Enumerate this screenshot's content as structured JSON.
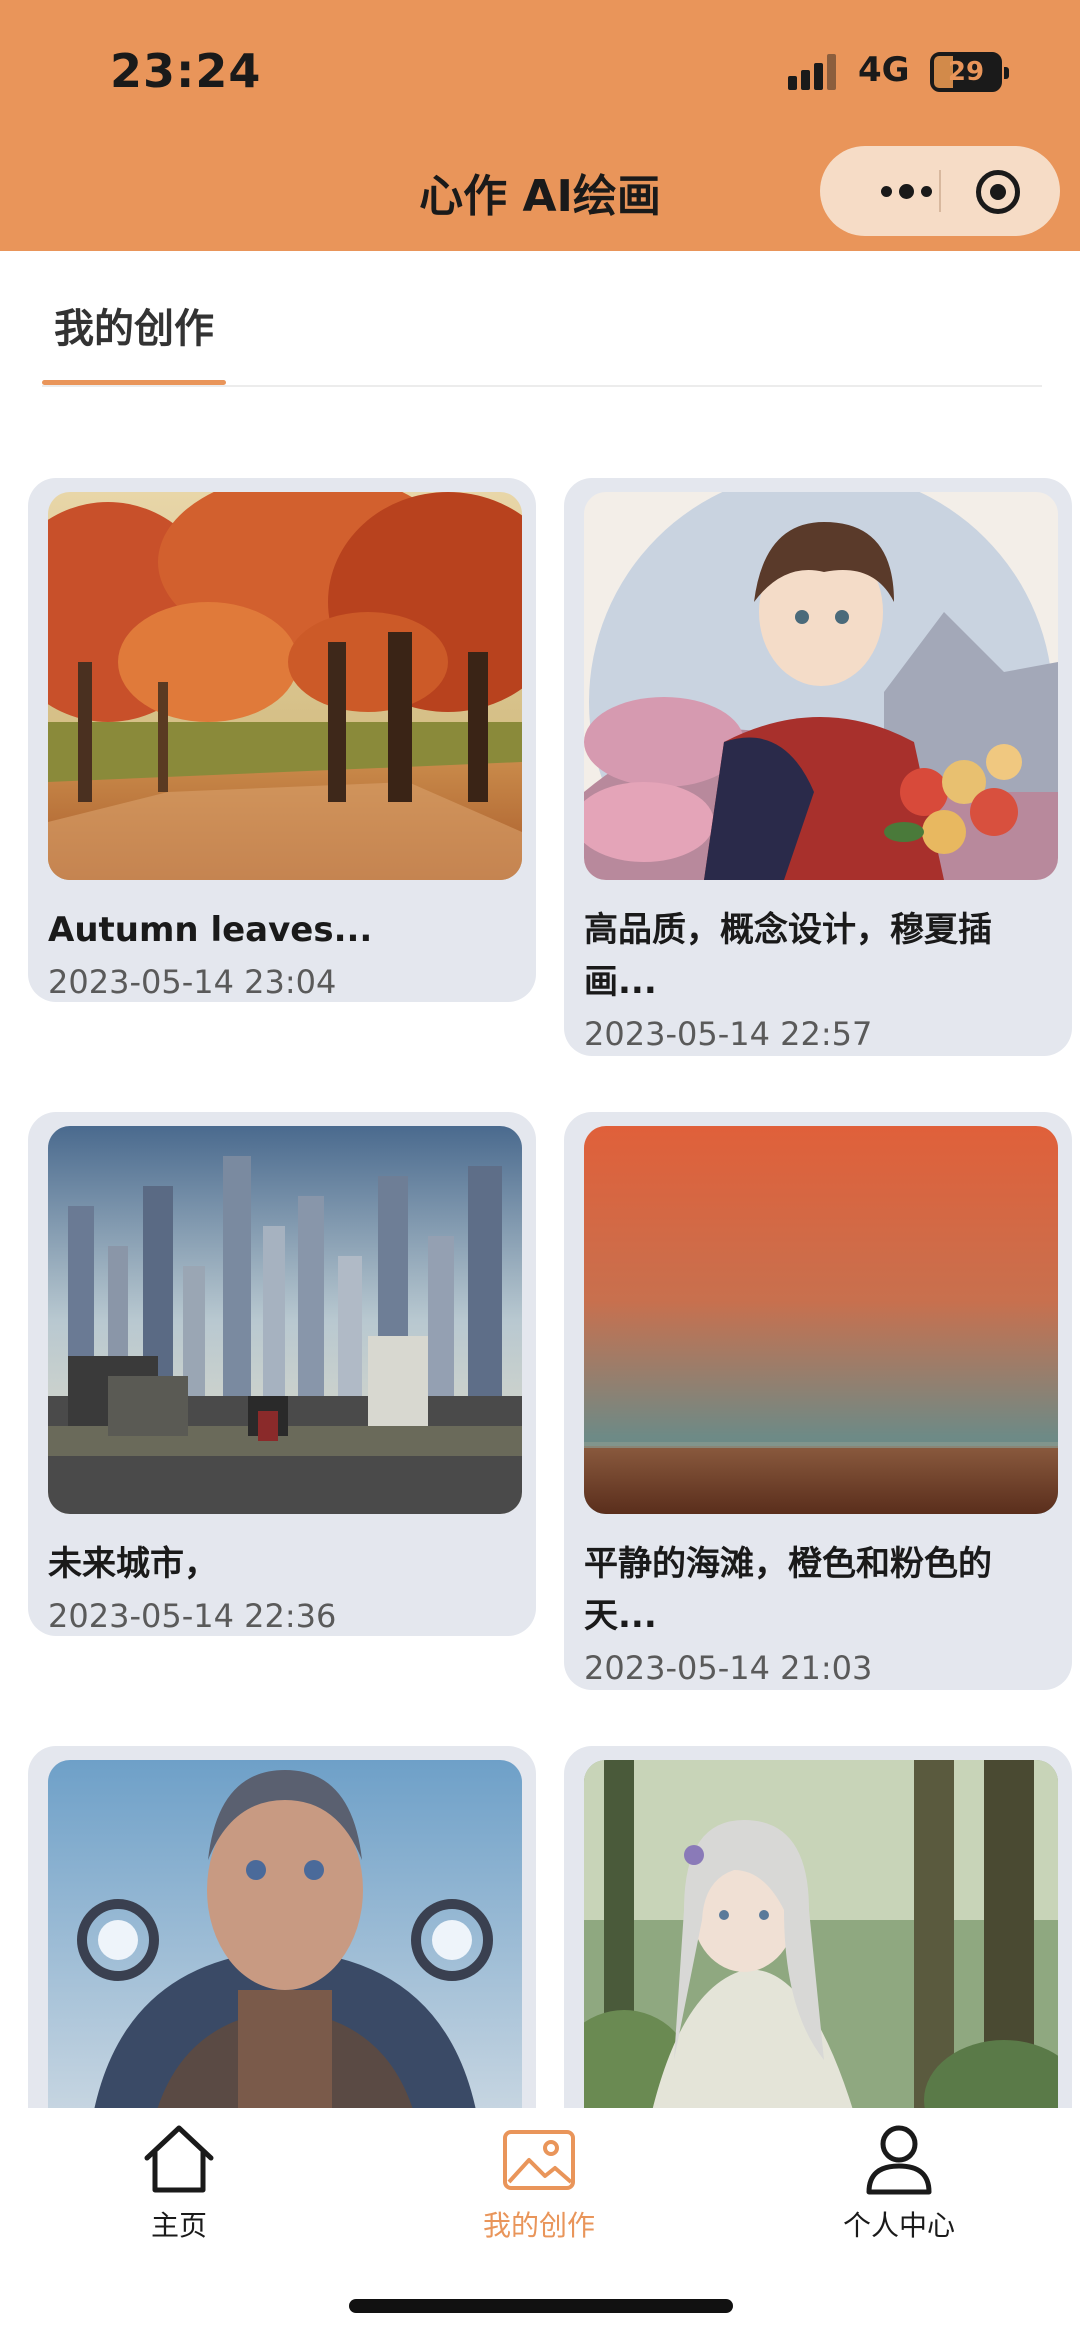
{
  "status_bar": {
    "time": "23:24",
    "network": "4G",
    "battery": "29"
  },
  "header": {
    "title": "心作 AI绘画",
    "capsule": {
      "more_icon": "more-dots-icon",
      "close_icon": "target-circle-icon"
    }
  },
  "tab": {
    "label": "我的创作"
  },
  "artworks": [
    {
      "title": "Autumn leaves...",
      "date": "2023-05-14 23:04",
      "image": "autumn-forest-path"
    },
    {
      "title": "高品质，概念设计，穆夏插画...",
      "date": "2023-05-14 22:57",
      "image": "anime-boy-with-roses"
    },
    {
      "title": "未来城市，",
      "date": "2023-05-14 22:36",
      "image": "futuristic-city"
    },
    {
      "title": "平静的海滩，橙色和粉色的天...",
      "date": "2023-05-14 21:03",
      "image": "calm-beach-sunset"
    },
    {
      "title": "",
      "date": "",
      "image": "cyborg-face"
    },
    {
      "title": "",
      "date": "",
      "image": "anime-girl-in-forest"
    }
  ],
  "bottom_nav": {
    "items": [
      {
        "label": "主页",
        "icon": "home-icon"
      },
      {
        "label": "我的创作",
        "icon": "image-icon",
        "active": true
      },
      {
        "label": "个人中心",
        "icon": "user-icon"
      }
    ],
    "active_color": "#e9955a"
  },
  "colors": {
    "header_bg": "#e9955a",
    "card_bg": "#e4e7ee"
  }
}
